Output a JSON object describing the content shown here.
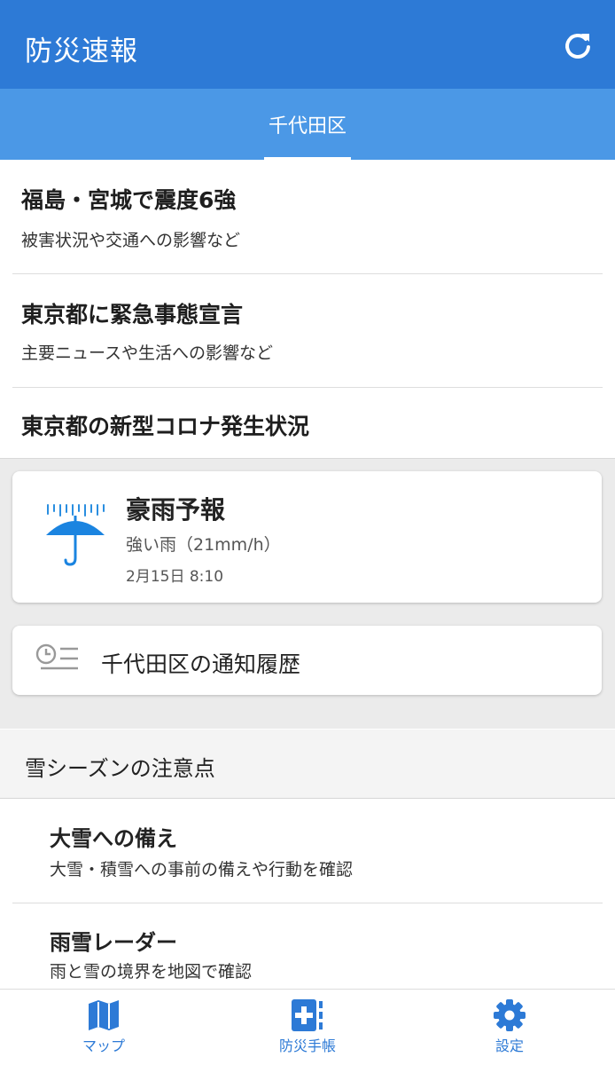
{
  "app": {
    "title": "防災速報"
  },
  "icons": {
    "refresh": "refresh-icon",
    "rain": "umbrella-rain-icon",
    "history": "clock-list-icon",
    "map": "map-icon",
    "notebook": "first-aid-notebook-icon",
    "settings": "gear-icon"
  },
  "colors": {
    "primary": "#2d7ad6",
    "tab_bar": "#4b98e6",
    "accent_umbrella": "#1b84e0"
  },
  "tabs": [
    {
      "label": "千代田区",
      "active": true
    }
  ],
  "news": [
    {
      "title": "福島・宮城で震度6強",
      "subtitle": "被害状況や交通への影響など"
    },
    {
      "title": "東京都に緊急事態宣言",
      "subtitle": "主要ニュースや生活への影響など"
    },
    {
      "title": "東京都の新型コロナ発生状況"
    }
  ],
  "alert": {
    "title": "豪雨予報",
    "detail": "強い雨（21mm/h）",
    "time": "2月15日 8:10"
  },
  "history": {
    "label": "千代田区の通知履歴"
  },
  "section": {
    "title": "雪シーズンの注意点",
    "items": [
      {
        "title": "大雪への備え",
        "subtitle": "大雪・積雪への事前の備えや行動を確認"
      },
      {
        "title": "雨雪レーダー",
        "subtitle": "雨と雪の境界を地図で確認"
      }
    ]
  },
  "bottom_nav": [
    {
      "label": "マップ"
    },
    {
      "label": "防災手帳"
    },
    {
      "label": "設定"
    }
  ]
}
